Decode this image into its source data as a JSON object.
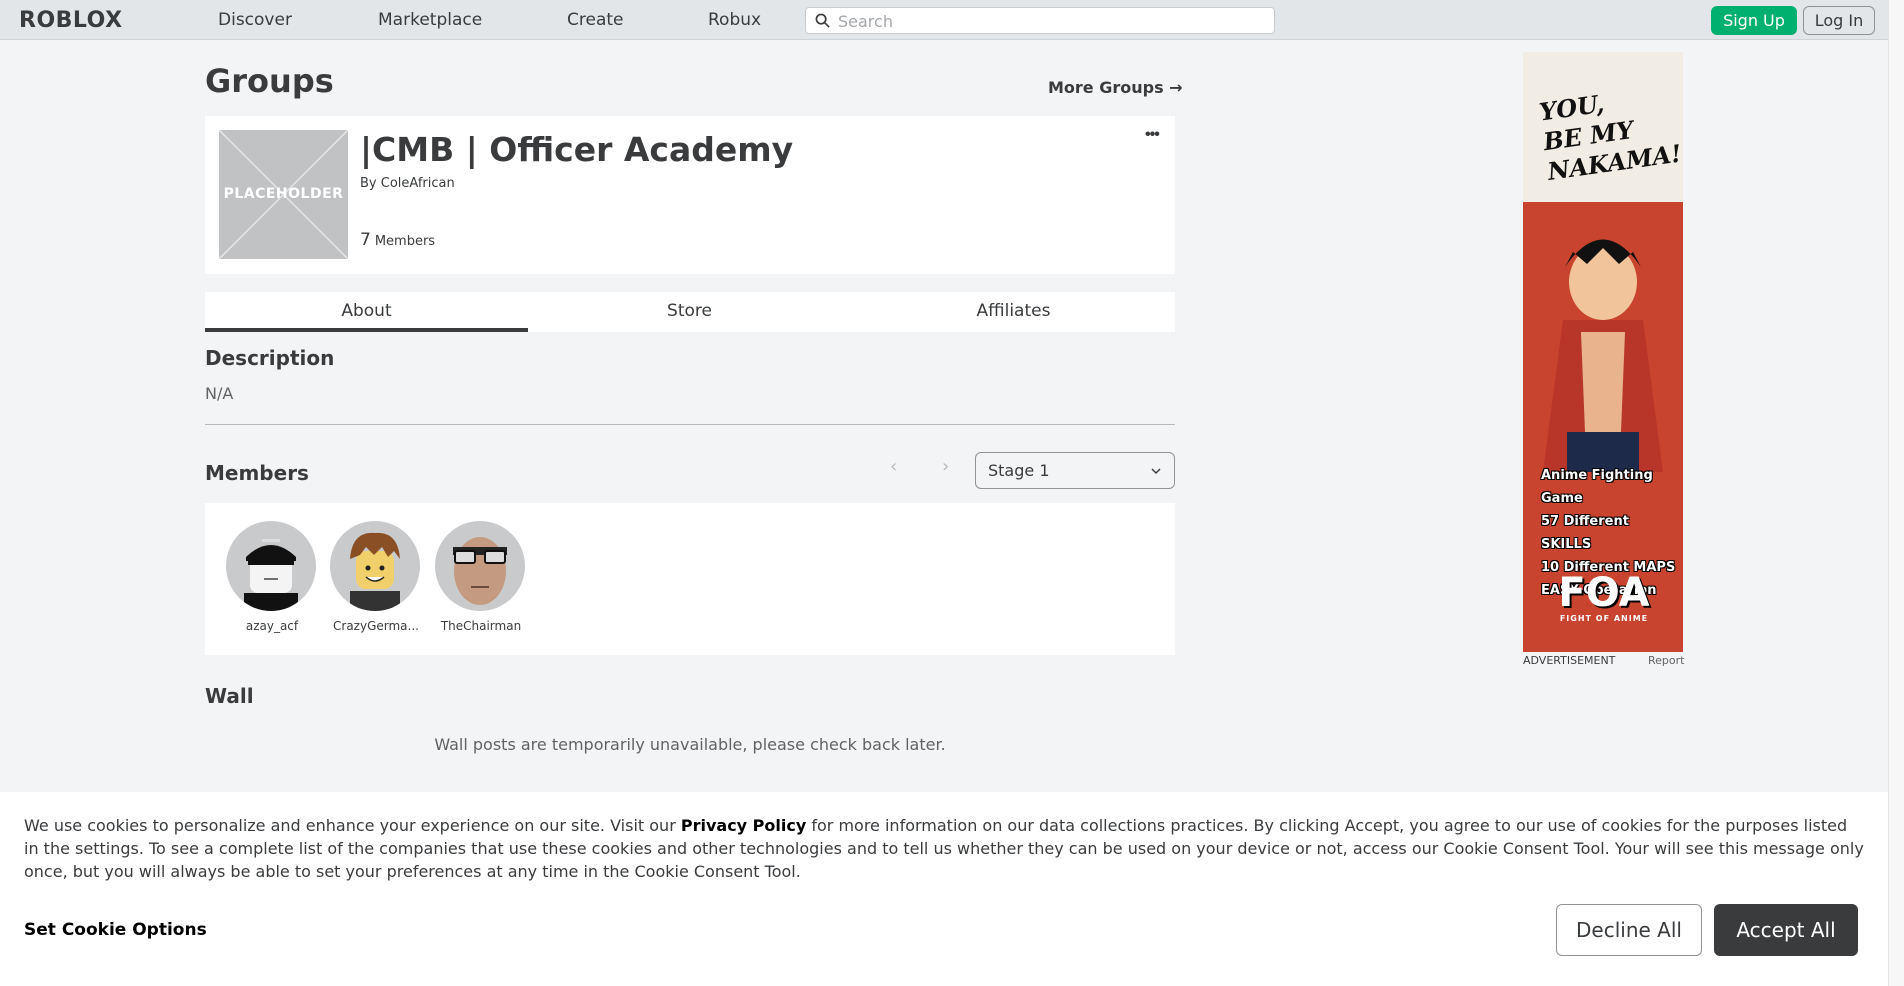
{
  "header": {
    "logo": "ROBLOX",
    "nav": [
      "Discover",
      "Marketplace",
      "Create",
      "Robux"
    ],
    "search_placeholder": "Search",
    "signup": "Sign Up",
    "login": "Log In"
  },
  "page": {
    "title": "Groups",
    "more_groups": "More Groups →"
  },
  "group": {
    "placeholder_text": "PLACEHOLDER",
    "name": "|CMB | Officer Academy",
    "by_prefix": "By",
    "owner": "ColeAfrican",
    "member_count": "7",
    "members_label": "Members",
    "more_icon": "•••"
  },
  "tabs": [
    "About",
    "Store",
    "Affiliates"
  ],
  "description": {
    "title": "Description",
    "text": "N/A"
  },
  "members": {
    "title": "Members",
    "prev": "‹",
    "next": "›",
    "role": "Stage 1",
    "list": [
      {
        "name": "azay_acf"
      },
      {
        "name": "CrazyGerma..."
      },
      {
        "name": "TheChairman"
      }
    ]
  },
  "wall": {
    "title": "Wall",
    "message": "Wall posts are temporarily unavailable, please check back later."
  },
  "ad": {
    "tagline": [
      "YOU,",
      "BE MY",
      "NAKAMA!"
    ],
    "lines": [
      "Anime Fighting Game",
      "57 Different SKILLS",
      "10 Different MAPS",
      "EASY Operation"
    ],
    "logo": "FOA",
    "logo_sub": "FIGHT OF ANIME",
    "label": "ADVERTISEMENT",
    "report": "Report"
  },
  "cookie": {
    "text_before": "We use cookies to personalize and enhance your experience on our site. Visit our ",
    "privacy_link": "Privacy Policy",
    "text_after": " for more information on our data collections practices. By clicking Accept, you agree to our use of cookies for the purposes listed in the settings. To see a complete list of the companies that use these cookies and other technologies and to tell us whether they can be used on your device or not, access our Cookie Consent Tool. Your will see this message only once, but you will always be able to set your preferences at any time in the Cookie Consent Tool.",
    "options": "Set Cookie Options",
    "decline": "Decline All",
    "accept": "Accept All"
  }
}
